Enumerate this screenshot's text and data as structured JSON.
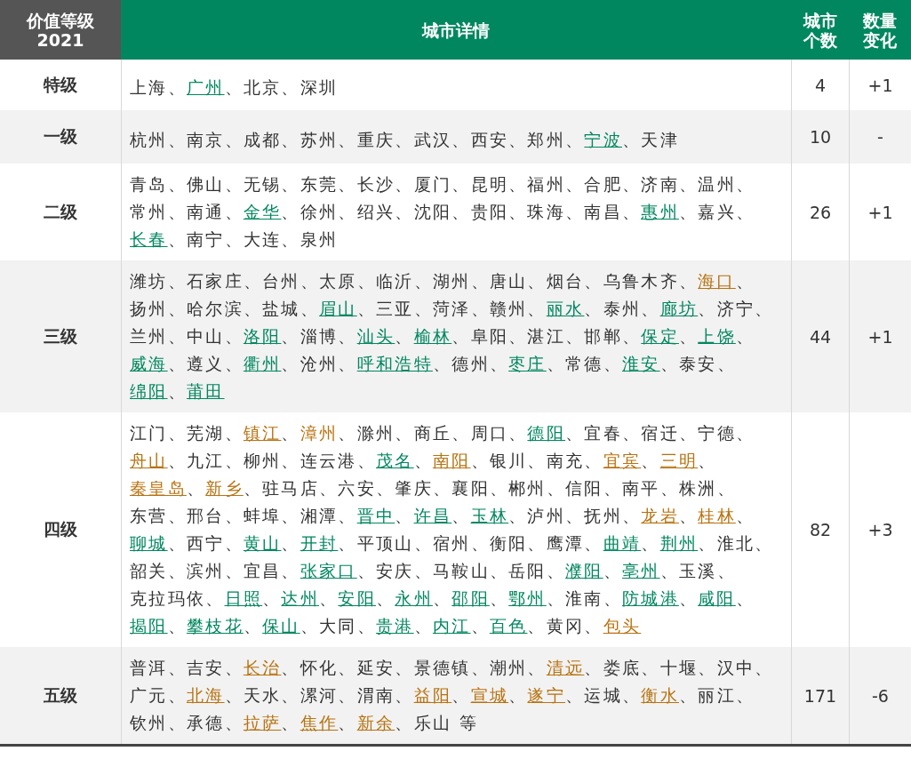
{
  "columns": [
    {
      "label": "价值等级 2021",
      "kind": "grade"
    },
    {
      "label": "城市详情",
      "kind": "detail"
    },
    {
      "label": "城市个数",
      "kind": "count"
    },
    {
      "label": "数量变化",
      "kind": "change"
    }
  ],
  "separator": "、",
  "rows": [
    {
      "grade": "特级",
      "cities": [
        {
          "name": "上海",
          "color": "#333333"
        },
        {
          "name": "广州",
          "color": "#00875f",
          "underlined": true
        },
        {
          "name": "北京",
          "color": "#333333"
        },
        {
          "name": "深圳",
          "color": "#333333"
        }
      ],
      "count": "4",
      "delta": "+1"
    },
    {
      "grade": "一级",
      "cities": [
        {
          "name": "杭州",
          "color": "#333333"
        },
        {
          "name": "南京",
          "color": "#333333"
        },
        {
          "name": "成都",
          "color": "#333333"
        },
        {
          "name": "苏州",
          "color": "#333333"
        },
        {
          "name": "重庆",
          "color": "#333333"
        },
        {
          "name": "武汉",
          "color": "#333333"
        },
        {
          "name": "西安",
          "color": "#333333"
        },
        {
          "name": "郑州",
          "color": "#333333"
        },
        {
          "name": "宁波",
          "color": "#00875f",
          "underlined": true
        },
        {
          "name": "天津",
          "color": "#333333"
        }
      ],
      "count": "10",
      "delta": "-"
    },
    {
      "grade": "二级",
      "cities": [
        {
          "name": "青岛",
          "color": "#333333"
        },
        {
          "name": "佛山",
          "color": "#333333"
        },
        {
          "name": "无锡",
          "color": "#333333"
        },
        {
          "name": "东莞",
          "color": "#333333"
        },
        {
          "name": "长沙",
          "color": "#333333"
        },
        {
          "name": "厦门",
          "color": "#333333"
        },
        {
          "name": "昆明",
          "color": "#333333"
        },
        {
          "name": "福州",
          "color": "#333333"
        },
        {
          "name": "合肥",
          "color": "#333333"
        },
        {
          "name": "济南",
          "color": "#333333"
        },
        {
          "name": "温州",
          "color": "#333333"
        },
        {
          "name": "常州",
          "color": "#333333"
        },
        {
          "name": "南通",
          "color": "#333333"
        },
        {
          "name": "金华",
          "color": "#00875f",
          "underlined": true
        },
        {
          "name": "徐州",
          "color": "#333333"
        },
        {
          "name": "绍兴",
          "color": "#333333"
        },
        {
          "name": "沈阳",
          "color": "#333333"
        },
        {
          "name": "贵阳",
          "color": "#333333"
        },
        {
          "name": "珠海",
          "color": "#333333"
        },
        {
          "name": "南昌",
          "color": "#333333"
        },
        {
          "name": "惠州",
          "color": "#00875f",
          "underlined": true
        },
        {
          "name": "嘉兴",
          "color": "#333333"
        },
        {
          "name": "长春",
          "color": "#00875f",
          "underlined": true
        },
        {
          "name": "南宁",
          "color": "#333333"
        },
        {
          "name": "大连",
          "color": "#333333"
        },
        {
          "name": "泉州",
          "color": "#333333"
        }
      ],
      "count": "26",
      "delta": "+1"
    },
    {
      "grade": "三级",
      "cities": [
        {
          "name": "潍坊",
          "color": "#333333"
        },
        {
          "name": "石家庄",
          "color": "#333333"
        },
        {
          "name": "台州",
          "color": "#333333"
        },
        {
          "name": "太原",
          "color": "#333333"
        },
        {
          "name": "临沂",
          "color": "#333333"
        },
        {
          "name": "湖州",
          "color": "#333333"
        },
        {
          "name": "唐山",
          "color": "#333333"
        },
        {
          "name": "烟台",
          "color": "#333333"
        },
        {
          "name": "乌鲁木齐",
          "color": "#333333"
        },
        {
          "name": "海口",
          "color": "#b8720f",
          "underlined": true
        },
        {
          "name": "扬州",
          "color": "#333333"
        },
        {
          "name": "哈尔滨",
          "color": "#333333"
        },
        {
          "name": "盐城",
          "color": "#333333"
        },
        {
          "name": "眉山",
          "color": "#00875f",
          "underlined": true
        },
        {
          "name": "三亚",
          "color": "#333333"
        },
        {
          "name": "菏泽",
          "color": "#333333"
        },
        {
          "name": "赣州",
          "color": "#333333"
        },
        {
          "name": "丽水",
          "color": "#00875f",
          "underlined": true
        },
        {
          "name": "泰州",
          "color": "#333333"
        },
        {
          "name": "廊坊",
          "color": "#00875f",
          "underlined": true
        },
        {
          "name": "济宁",
          "color": "#333333"
        },
        {
          "name": "兰州",
          "color": "#333333"
        },
        {
          "name": "中山",
          "color": "#333333"
        },
        {
          "name": "洛阳",
          "color": "#00875f",
          "underlined": true
        },
        {
          "name": "淄博",
          "color": "#333333"
        },
        {
          "name": "汕头",
          "color": "#00875f",
          "underlined": true
        },
        {
          "name": "榆林",
          "color": "#00875f",
          "underlined": true
        },
        {
          "name": "阜阳",
          "color": "#333333"
        },
        {
          "name": "湛江",
          "color": "#333333"
        },
        {
          "name": "邯郸",
          "color": "#333333"
        },
        {
          "name": "保定",
          "color": "#00875f",
          "underlined": true
        },
        {
          "name": "上饶",
          "color": "#00875f",
          "underlined": true
        },
        {
          "name": "威海",
          "color": "#00875f",
          "underlined": true
        },
        {
          "name": "遵义",
          "color": "#333333"
        },
        {
          "name": "衢州",
          "color": "#00875f",
          "underlined": true
        },
        {
          "name": "沧州",
          "color": "#333333"
        },
        {
          "name": "呼和浩特",
          "color": "#00875f",
          "underlined": true
        },
        {
          "name": "德州",
          "color": "#333333"
        },
        {
          "name": "枣庄",
          "color": "#00875f",
          "underlined": true
        },
        {
          "name": "常德",
          "color": "#333333"
        },
        {
          "name": "淮安",
          "color": "#00875f",
          "underlined": true
        },
        {
          "name": "泰安",
          "color": "#333333"
        },
        {
          "name": "绵阳",
          "color": "#00875f",
          "underlined": true
        },
        {
          "name": "莆田",
          "color": "#00875f",
          "underlined": true
        }
      ],
      "count": "44",
      "delta": "+1"
    },
    {
      "grade": "四级",
      "cities": [
        {
          "name": "江门",
          "color": "#333333"
        },
        {
          "name": "芜湖",
          "color": "#333333"
        },
        {
          "name": "镇江",
          "color": "#b8720f",
          "underlined": true
        },
        {
          "name": "漳州",
          "color": "#b8720f"
        },
        {
          "name": "滁州",
          "color": "#333333"
        },
        {
          "name": "商丘",
          "color": "#333333"
        },
        {
          "name": "周口",
          "color": "#333333"
        },
        {
          "name": "德阳",
          "color": "#00875f",
          "underlined": true
        },
        {
          "name": "宜春",
          "color": "#333333"
        },
        {
          "name": "宿迁",
          "color": "#333333"
        },
        {
          "name": "宁德",
          "color": "#333333"
        },
        {
          "name": "舟山",
          "color": "#b8720f",
          "underlined": true
        },
        {
          "name": "九江",
          "color": "#333333"
        },
        {
          "name": "柳州",
          "color": "#333333"
        },
        {
          "name": "连云港",
          "color": "#333333"
        },
        {
          "name": "茂名",
          "color": "#00875f",
          "underlined": true
        },
        {
          "name": "南阳",
          "color": "#b8720f",
          "underlined": true
        },
        {
          "name": "银川",
          "color": "#333333"
        },
        {
          "name": "南充",
          "color": "#333333"
        },
        {
          "name": "宜宾",
          "color": "#b8720f",
          "underlined": true
        },
        {
          "name": "三明",
          "color": "#b8720f",
          "underlined": true
        },
        {
          "name": "秦皇岛",
          "color": "#b8720f",
          "underlined": true
        },
        {
          "name": "新乡",
          "color": "#b8720f",
          "underlined": true
        },
        {
          "name": "驻马店",
          "color": "#333333"
        },
        {
          "name": "六安",
          "color": "#333333"
        },
        {
          "name": "肇庆",
          "color": "#333333"
        },
        {
          "name": "襄阳",
          "color": "#333333"
        },
        {
          "name": "郴州",
          "color": "#333333"
        },
        {
          "name": "信阳",
          "color": "#333333"
        },
        {
          "name": "南平",
          "color": "#333333"
        },
        {
          "name": "株洲",
          "color": "#333333"
        },
        {
          "name": "东营",
          "color": "#333333"
        },
        {
          "name": "邢台",
          "color": "#333333"
        },
        {
          "name": "蚌埠",
          "color": "#333333"
        },
        {
          "name": "湘潭",
          "color": "#333333"
        },
        {
          "name": "晋中",
          "color": "#00875f",
          "underlined": true
        },
        {
          "name": "许昌",
          "color": "#00875f",
          "underlined": true
        },
        {
          "name": "玉林",
          "color": "#00875f",
          "underlined": true
        },
        {
          "name": "泸州",
          "color": "#333333"
        },
        {
          "name": "抚州",
          "color": "#333333"
        },
        {
          "name": "龙岩",
          "color": "#b8720f",
          "underlined": true
        },
        {
          "name": "桂林",
          "color": "#b8720f",
          "underlined": true
        },
        {
          "name": "聊城",
          "color": "#00875f",
          "underlined": true
        },
        {
          "name": "西宁",
          "color": "#333333"
        },
        {
          "name": "黄山",
          "color": "#00875f",
          "underlined": true
        },
        {
          "name": "开封",
          "color": "#00875f",
          "underlined": true
        },
        {
          "name": "平顶山",
          "color": "#333333"
        },
        {
          "name": "宿州",
          "color": "#333333"
        },
        {
          "name": "衡阳",
          "color": "#333333"
        },
        {
          "name": "鹰潭",
          "color": "#333333"
        },
        {
          "name": "曲靖",
          "color": "#00875f",
          "underlined": true
        },
        {
          "name": "荆州",
          "color": "#00875f",
          "underlined": true
        },
        {
          "name": "淮北",
          "color": "#333333"
        },
        {
          "name": "韶关",
          "color": "#333333"
        },
        {
          "name": "滨州",
          "color": "#333333"
        },
        {
          "name": "宜昌",
          "color": "#333333"
        },
        {
          "name": "张家口",
          "color": "#00875f",
          "underlined": true
        },
        {
          "name": "安庆",
          "color": "#333333"
        },
        {
          "name": "马鞍山",
          "color": "#333333"
        },
        {
          "name": "岳阳",
          "color": "#333333"
        },
        {
          "name": "濮阳",
          "color": "#00875f",
          "underlined": true
        },
        {
          "name": "亳州",
          "color": "#00875f",
          "underlined": true
        },
        {
          "name": "玉溪",
          "color": "#333333"
        },
        {
          "name": "克拉玛依",
          "color": "#333333"
        },
        {
          "name": "日照",
          "color": "#00875f",
          "underlined": true
        },
        {
          "name": "达州",
          "color": "#00875f",
          "underlined": true
        },
        {
          "name": "安阳",
          "color": "#00875f",
          "underlined": true
        },
        {
          "name": "永州",
          "color": "#00875f",
          "underlined": true
        },
        {
          "name": "邵阳",
          "color": "#00875f",
          "underlined": true
        },
        {
          "name": "鄂州",
          "color": "#00875f",
          "underlined": true
        },
        {
          "name": "淮南",
          "color": "#333333"
        },
        {
          "name": "防城港",
          "color": "#00875f",
          "underlined": true
        },
        {
          "name": "咸阳",
          "color": "#00875f",
          "underlined": true
        },
        {
          "name": "揭阳",
          "color": "#00875f",
          "underlined": true
        },
        {
          "name": "攀枝花",
          "color": "#00875f",
          "underlined": true
        },
        {
          "name": "保山",
          "color": "#00875f",
          "underlined": true
        },
        {
          "name": "大同",
          "color": "#333333"
        },
        {
          "name": "贵港",
          "color": "#00875f",
          "underlined": true
        },
        {
          "name": "内江",
          "color": "#00875f",
          "underlined": true
        },
        {
          "name": "百色",
          "color": "#00875f",
          "underlined": true
        },
        {
          "name": "黄冈",
          "color": "#333333"
        },
        {
          "name": "包头",
          "color": "#b8720f",
          "underlined": true
        }
      ],
      "count": "82",
      "delta": "+3"
    },
    {
      "grade": "五级",
      "cities": [
        {
          "name": "普洱",
          "color": "#333333"
        },
        {
          "name": "吉安",
          "color": "#333333"
        },
        {
          "name": "长治",
          "color": "#b8720f",
          "underlined": true
        },
        {
          "name": "怀化",
          "color": "#333333"
        },
        {
          "name": "延安",
          "color": "#333333"
        },
        {
          "name": "景德镇",
          "color": "#333333"
        },
        {
          "name": "潮州",
          "color": "#333333"
        },
        {
          "name": "清远",
          "color": "#b8720f",
          "underlined": true
        },
        {
          "name": "娄底",
          "color": "#333333"
        },
        {
          "name": "十堰",
          "color": "#333333"
        },
        {
          "name": "汉中",
          "color": "#333333"
        },
        {
          "name": "广元",
          "color": "#333333"
        },
        {
          "name": "北海",
          "color": "#b8720f",
          "underlined": true
        },
        {
          "name": "天水",
          "color": "#333333"
        },
        {
          "name": "漯河",
          "color": "#333333"
        },
        {
          "name": "渭南",
          "color": "#333333"
        },
        {
          "name": "益阳",
          "color": "#b8720f",
          "underlined": true
        },
        {
          "name": "宣城",
          "color": "#b8720f",
          "underlined": true
        },
        {
          "name": "遂宁",
          "color": "#b8720f",
          "underlined": true
        },
        {
          "name": "运城",
          "color": "#333333"
        },
        {
          "name": "衡水",
          "color": "#b8720f",
          "underlined": true
        },
        {
          "name": "丽江",
          "color": "#333333"
        },
        {
          "name": "钦州",
          "color": "#333333"
        },
        {
          "name": "承德",
          "color": "#333333"
        },
        {
          "name": "拉萨",
          "color": "#b8720f",
          "underlined": true
        },
        {
          "name": "焦作",
          "color": "#b8720f",
          "underlined": true
        },
        {
          "name": "新余",
          "color": "#b8720f",
          "underlined": true
        },
        {
          "name": "乐山",
          "color": "#333333"
        }
      ],
      "suffix": "等",
      "count": "171",
      "delta": "-6"
    }
  ]
}
